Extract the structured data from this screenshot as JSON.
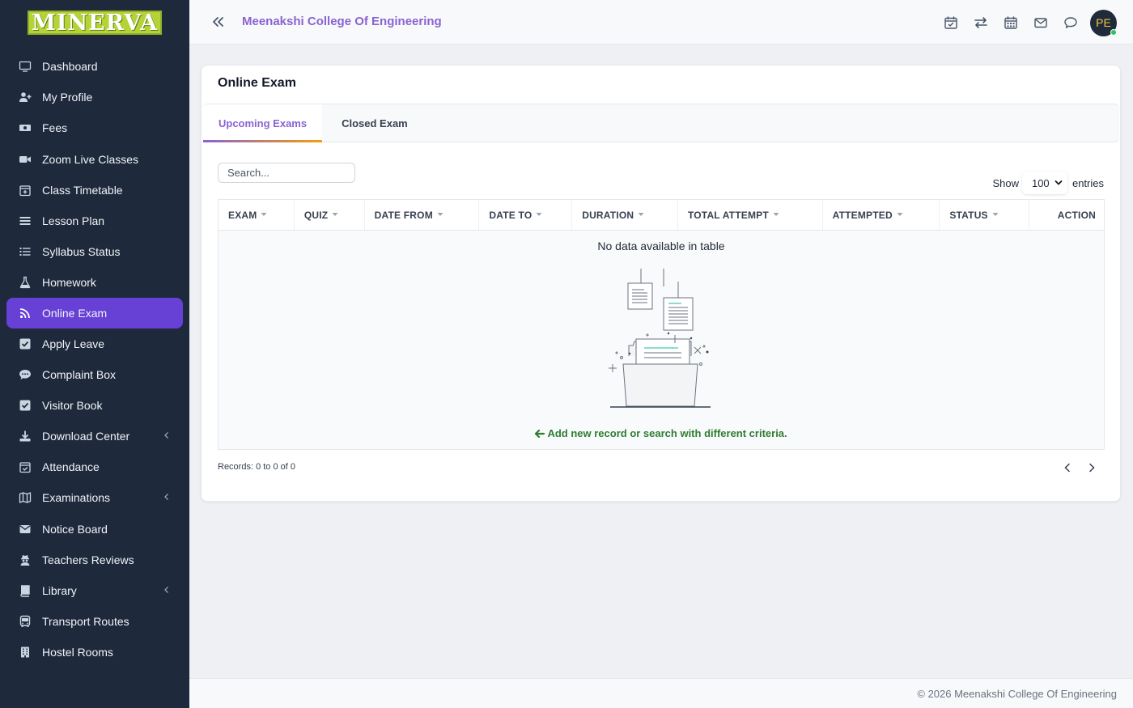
{
  "app": {
    "logo_text": "MINERVA",
    "college_name": "Meenakshi College Of Engineering"
  },
  "sidebar": {
    "items": [
      {
        "label": "Dashboard",
        "icon": "monitor-icon"
      },
      {
        "label": "My Profile",
        "icon": "user-plus-icon"
      },
      {
        "label": "Fees",
        "icon": "money-icon"
      },
      {
        "label": "Zoom Live Classes",
        "icon": "video-icon"
      },
      {
        "label": "Class Timetable",
        "icon": "calendar-plus-icon"
      },
      {
        "label": "Lesson Plan",
        "icon": "list-icon"
      },
      {
        "label": "Syllabus Status",
        "icon": "list-ol-icon"
      },
      {
        "label": "Homework",
        "icon": "flask-icon"
      },
      {
        "label": "Online Exam",
        "icon": "rss-icon",
        "active": true
      },
      {
        "label": "Apply Leave",
        "icon": "check-square-icon"
      },
      {
        "label": "Complaint Box",
        "icon": "comment-icon"
      },
      {
        "label": "Visitor Book",
        "icon": "check-square-icon"
      },
      {
        "label": "Download Center",
        "icon": "download-icon",
        "has_submenu": true
      },
      {
        "label": "Attendance",
        "icon": "calendar-check-icon"
      },
      {
        "label": "Examinations",
        "icon": "map-icon",
        "has_submenu": true
      },
      {
        "label": "Notice Board",
        "icon": "envelope-icon"
      },
      {
        "label": "Teachers Reviews",
        "icon": "user-secret-icon"
      },
      {
        "label": "Library",
        "icon": "book-icon",
        "has_submenu": true
      },
      {
        "label": "Transport Routes",
        "icon": "bus-icon"
      },
      {
        "label": "Hostel Rooms",
        "icon": "building-icon"
      }
    ]
  },
  "topbar": {
    "avatar_initials": "PE"
  },
  "page": {
    "title": "Online Exam",
    "tabs": [
      "Upcoming Exams",
      "Closed Exam"
    ],
    "search_placeholder": "Search...",
    "show_label": "Show",
    "entries_value": "100",
    "entries_label": "entries",
    "columns": [
      "EXAM",
      "QUIZ",
      "DATE FROM",
      "DATE TO",
      "DURATION",
      "TOTAL ATTEMPT",
      "ATTEMPTED",
      "STATUS",
      "ACTION"
    ],
    "empty_text": "No data available in table",
    "add_new_text": "Add new record or search with different criteria.",
    "records_text": "Records: 0 to 0 of 0"
  },
  "footer": {
    "text": "© 2026 Meenakshi College Of Engineering"
  },
  "colors": {
    "sidebar_bg": "#1e293b",
    "accent": "#6740d6",
    "brand_text": "#8a63d2",
    "success": "#2e7d32"
  }
}
